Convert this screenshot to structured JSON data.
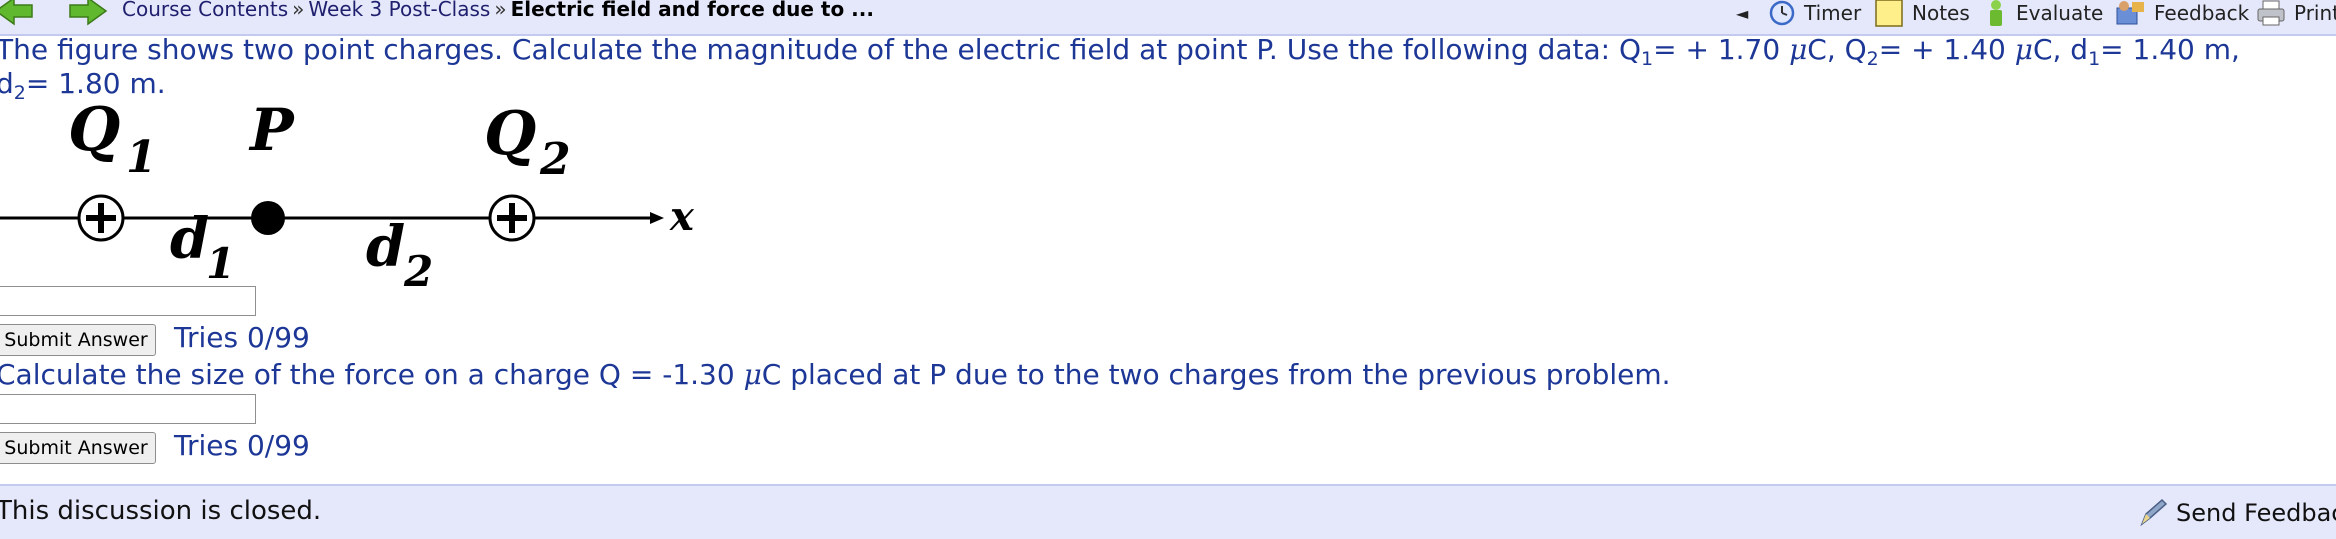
{
  "nav": {
    "breadcrumbs": [
      "Course Contents",
      "Week 3 Post-Class"
    ],
    "separator": "»",
    "current": "Electric field and force due to ...",
    "collapse_glyph": "◄",
    "tools": [
      {
        "label": "Timer",
        "icon": "clock-icon"
      },
      {
        "label": "Notes",
        "icon": "notes-icon"
      },
      {
        "label": "Evaluate",
        "icon": "evaluate-icon"
      },
      {
        "label": "Feedback",
        "icon": "feedback-icon"
      },
      {
        "label": "Print",
        "icon": "printer-icon"
      }
    ]
  },
  "problem1": {
    "line1_prefix": "The figure shows two point charges. Calculate the magnitude of the electric field at point P. Use the following data: Q",
    "q1_sub": "1",
    "q1_eq": "= + 1.70 ",
    "mu": "μ",
    "q1_unit": "C, Q",
    "q2_sub": "2",
    "q2_eq": "= + 1.40 ",
    "q2_unit": "C, d",
    "d1_sub": "1",
    "d1_eq": "= 1.40 m,",
    "line2_prefix": "d",
    "d2_sub": "2",
    "d2_eq": "= 1.80 m.",
    "submit_label": "Submit Answer",
    "tries": "Tries 0/99"
  },
  "figure": {
    "q1_letter": "Q",
    "q1_index": "1",
    "p_label": "P",
    "q2_letter": "Q",
    "q2_index": "2",
    "d1_letter": "d",
    "d1_index": "1",
    "d2_letter": "d",
    "d2_index": "2",
    "axis_label": "x"
  },
  "problem2": {
    "text_prefix": "Calculate the size of the force on a charge Q = -1.30 ",
    "mu": "μ",
    "text_suffix": "C placed at P due to the two charges from the previous problem.",
    "submit_label": "Submit Answer",
    "tries": "Tries 0/99"
  },
  "footer": {
    "closed_text": "This discussion is closed.",
    "send_feedback": "Send Feedback"
  },
  "colors": {
    "nav_bg": "#e5e8fb",
    "question_text": "#1d3797",
    "arrow_green": "#5fb82e"
  }
}
